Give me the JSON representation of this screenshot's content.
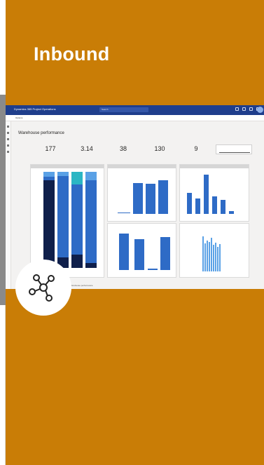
{
  "card": {
    "title": "Inbound",
    "bg_color": "#c97d06",
    "icon": "network-nodes-icon"
  },
  "screenshot": {
    "app_title": "Dynamics 365 Project Operations",
    "search_placeholder": "Search",
    "cmd_item": "Options",
    "page_heading": "Warehouse performance",
    "kpis": [
      "177",
      "3.14",
      "38",
      "130",
      "9"
    ],
    "bottom_tabs": "Inbound    Warehouse performance",
    "bar_colors": {
      "dark": "#0f1f4b",
      "mid": "#2e6bc6",
      "light": "#5aa1e6",
      "teal": "#2bb6c4"
    }
  }
}
